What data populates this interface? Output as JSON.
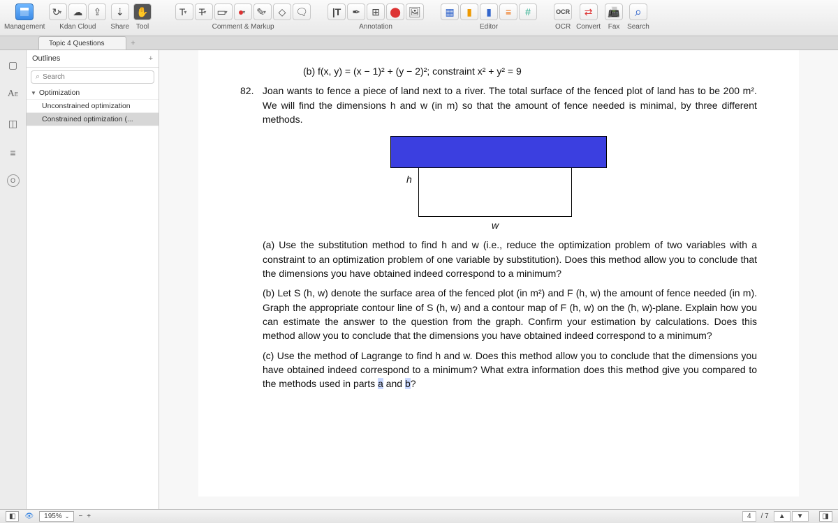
{
  "toolbar": {
    "groups": [
      {
        "label": "Management",
        "icons": [
          "app"
        ]
      },
      {
        "label": "Kdan Cloud",
        "icons": [
          "cloud-undo",
          "cloud",
          "upload"
        ]
      },
      {
        "label": "Share",
        "icons": [
          "share"
        ]
      },
      {
        "label": "Tool",
        "icons": [
          "hand"
        ]
      },
      {
        "label": "Comment & Markup",
        "icons": [
          "text-t",
          "text-strike",
          "rect",
          "circle",
          "pencil",
          "eraser",
          "note"
        ]
      },
      {
        "label": "Annotation",
        "icons": [
          "text-box",
          "sign",
          "form",
          "stamp",
          "image"
        ]
      },
      {
        "label": "Editor",
        "icons": [
          "grid",
          "file-y",
          "file-b",
          "list",
          "hash"
        ]
      },
      {
        "label": "OCR",
        "icons": [
          "ocr"
        ]
      },
      {
        "label": "Convert",
        "icons": [
          "convert"
        ]
      },
      {
        "label": "Fax",
        "icons": [
          "fax"
        ]
      },
      {
        "label": "Search",
        "icons": [
          "search"
        ]
      }
    ]
  },
  "tab": {
    "title": "Topic 4 Questions",
    "add": "+"
  },
  "sidebar": {
    "title": "Outlines",
    "add": "+",
    "search_placeholder": "Search",
    "tree": {
      "root": "Optimization",
      "children": [
        "Unconstrained optimization",
        "Constrained optimization (..."
      ]
    }
  },
  "doc": {
    "line_b_prev": "(b)  f(x, y) = (x − 1)² + (y − 2)²; constraint x² + y² = 9",
    "q82_num": "82.",
    "q82_text": "Joan wants to fence a piece of land next to a river. The total surface of the fenced plot of land has to be 200 m². We will find the dimensions h and w (in m) so that the amount of fence needed is minimal, by three different methods.",
    "diag_h": "h",
    "diag_w": "w",
    "part_a_label": "(a)",
    "part_a": "Use the substitution method to find h and w (i.e., reduce the optimization problem of two variables with a constraint to an optimization problem of one variable by substitution). Does this method allow you to conclude that the dimensions you have obtained indeed correspond to a minimum?",
    "part_b_label": "(b)",
    "part_b": "Let S (h, w) denote the surface area of the fenced plot (in m²) and F (h, w) the amount of fence needed (in m). Graph the appropriate contour line of S (h, w) and a contour map of F (h, w) on the (h, w)-plane. Explain how you can estimate the answer to the question from the graph. Confirm your estimation by calculations. Does this method allow you to conclude that the dimensions you have obtained indeed correspond to a minimum?",
    "part_c_label": "(c)",
    "part_c_1": "Use the method of Lagrange to find h and w. Does this method allow you to conclude that the dimensions you have obtained indeed correspond to a minimum? What extra information does this method give you compared to the methods used in parts ",
    "part_c_a": "a",
    "part_c_and": " and ",
    "part_c_b": "b",
    "part_c_q": "?"
  },
  "footer": {
    "zoom": "195%",
    "page_current": "4",
    "page_sep": "/ 7"
  }
}
